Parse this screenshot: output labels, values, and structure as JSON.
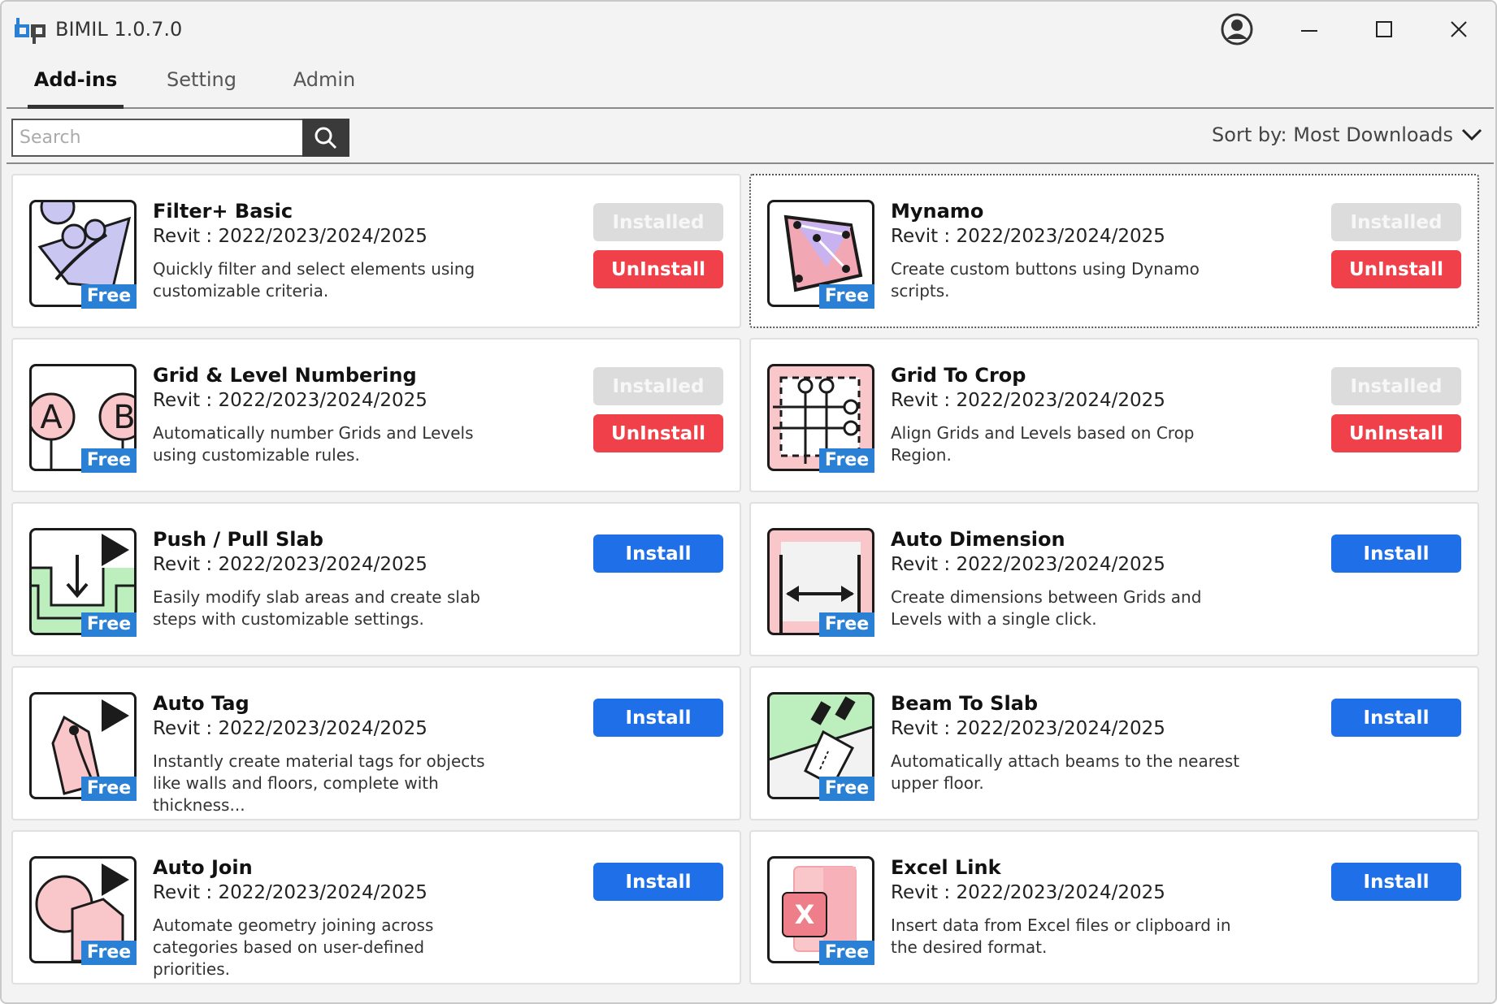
{
  "window": {
    "title": "BIMIL 1.0.7.0",
    "icons": [
      "app-logo-icon",
      "user-icon",
      "minimize-icon",
      "maximize-icon",
      "close-icon"
    ]
  },
  "tabs": [
    {
      "label": "Add-ins",
      "active": true
    },
    {
      "label": "Setting",
      "active": false
    },
    {
      "label": "Admin",
      "active": false
    }
  ],
  "search": {
    "placeholder": "Search",
    "value": ""
  },
  "sort": {
    "label": "Sort by: Most Downloads"
  },
  "colors": {
    "install": "#1e6fe8",
    "uninstall": "#f0404a",
    "installed": "#dcdcdc",
    "free_badge": "#2a80d4"
  },
  "addins": [
    {
      "title": "Filter+ Basic",
      "compat": "Revit : 2022/2023/2024/2025",
      "desc": "Quickly filter and select elements using customizable criteria.",
      "badge": "Free",
      "installed_label": "Installed",
      "uninstall_label": "UnInstall",
      "icon": "filter-icon"
    },
    {
      "title": "Mynamo",
      "compat": "Revit : 2022/2023/2024/2025",
      "desc": "Create custom buttons using Dynamo scripts.",
      "badge": "Free",
      "installed_label": "Installed",
      "uninstall_label": "UnInstall",
      "icon": "dynamo-icon"
    },
    {
      "title": "Grid & Level Numbering",
      "compat": "Revit : 2022/2023/2024/2025",
      "desc": "Automatically number Grids and Levels using customizable rules.",
      "badge": "Free",
      "installed_label": "Installed",
      "uninstall_label": "UnInstall",
      "icon": "grid-numbering-icon",
      "icon_text_a": "A",
      "icon_text_b": "B"
    },
    {
      "title": "Grid To Crop",
      "compat": "Revit : 2022/2023/2024/2025",
      "desc": "Align Grids and Levels based on Crop Region.",
      "badge": "Free",
      "installed_label": "Installed",
      "uninstall_label": "UnInstall",
      "icon": "grid-crop-icon"
    },
    {
      "title": "Push / Pull Slab",
      "compat": "Revit : 2022/2023/2024/2025",
      "desc": "Easily modify slab areas and create slab steps with customizable settings.",
      "badge": "Free",
      "install_label": "Install",
      "icon": "slab-icon"
    },
    {
      "title": "Auto Dimension",
      "compat": "Revit : 2022/2023/2024/2025",
      "desc": "Create dimensions between Grids and Levels with a single click.",
      "badge": "Free",
      "install_label": "Install",
      "icon": "dimension-icon"
    },
    {
      "title": "Auto Tag",
      "compat": "Revit : 2022/2023/2024/2025",
      "desc": "Instantly create material tags for objects like walls and floors, complete with thickness...",
      "badge": "Free",
      "install_label": "Install",
      "icon": "tag-icon"
    },
    {
      "title": "Beam To Slab",
      "compat": "Revit : 2022/2023/2024/2025",
      "desc": "Automatically attach beams to the nearest upper floor.",
      "badge": "Free",
      "install_label": "Install",
      "icon": "beam-slab-icon"
    },
    {
      "title": "Auto Join",
      "compat": "Revit : 2022/2023/2024/2025",
      "desc": "Automate geometry joining across categories based on user-defined priorities.",
      "badge": "Free",
      "install_label": "Install",
      "icon": "join-icon"
    },
    {
      "title": "Excel Link",
      "compat": "Revit : 2022/2023/2024/2025",
      "desc": "Insert data from Excel files or clipboard in the desired format.",
      "badge": "Free",
      "install_label": "Install",
      "icon": "excel-icon",
      "icon_text": "X"
    }
  ]
}
